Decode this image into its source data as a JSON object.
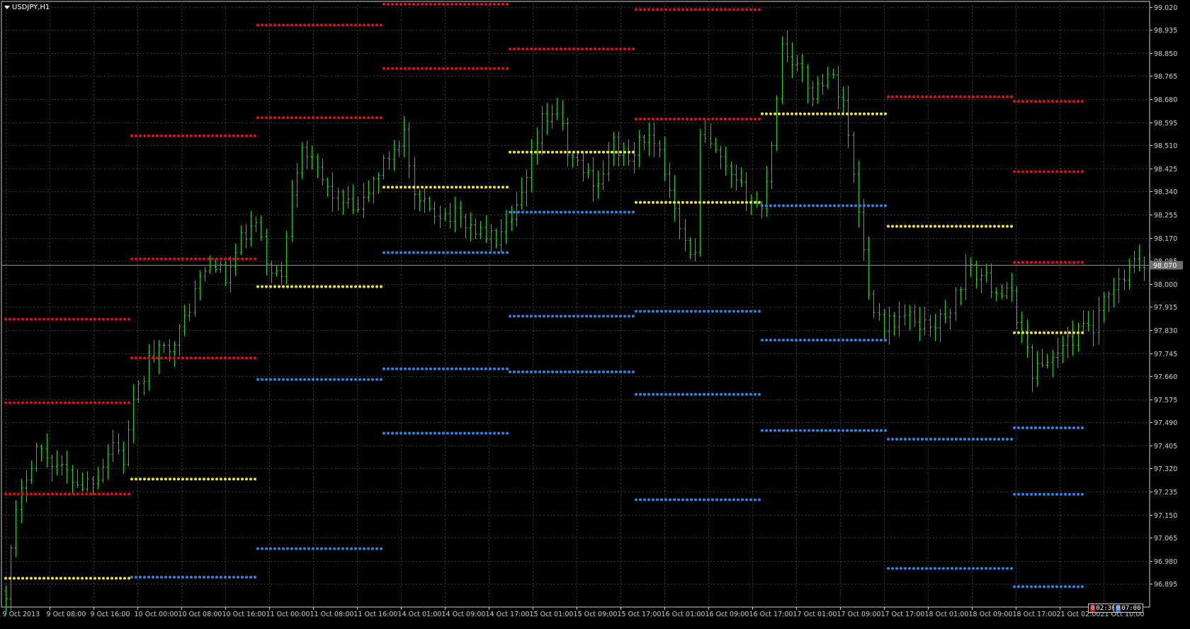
{
  "window": {
    "symbol_label": "USDJPY,H1"
  },
  "current_price": "98.070",
  "timers": [
    {
      "mark": "0",
      "text": "02:30"
    },
    {
      "mark": "0",
      "text": "07:00"
    }
  ],
  "colors": {
    "background": "#000000",
    "grid": "#3a3a3a",
    "axis": "#cfcfcf",
    "candle": "#1fd11f",
    "resistance": "#e01010",
    "pivot": "#f2e61c",
    "support": "#2a86e6",
    "price_line": "#8a8a8a"
  },
  "chart_data": {
    "type": "line",
    "symbol": "USDJPY",
    "timeframe": "H1",
    "y_ticks": [
      "99.020",
      "98.935",
      "98.850",
      "98.765",
      "98.680",
      "98.595",
      "98.510",
      "98.425",
      "98.340",
      "98.255",
      "98.170",
      "98.085",
      "98.000",
      "97.915",
      "97.830",
      "97.745",
      "97.660",
      "97.575",
      "97.490",
      "97.405",
      "97.320",
      "97.235",
      "97.150",
      "97.065",
      "96.980",
      "96.895"
    ],
    "ylim": [
      96.81,
      99.04
    ],
    "x_ticks": [
      "9 Oct 2013",
      "9 Oct 08:00",
      "9 Oct 16:00",
      "10 Oct 00:00",
      "10 Oct 08:00",
      "10 Oct 16:00",
      "11 Oct 00:00",
      "11 Oct 08:00",
      "11 Oct 16:00",
      "14 Oct 01:00",
      "14 Oct 09:00",
      "14 Oct 17:00",
      "15 Oct 01:00",
      "15 Oct 09:00",
      "15 Oct 17:00",
      "16 Oct 01:00",
      "16 Oct 09:00",
      "16 Oct 17:00",
      "17 Oct 01:00",
      "17 Oct 09:00",
      "17 Oct 17:00",
      "18 Oct 01:00",
      "18 Oct 09:00",
      "18 Oct 17:00",
      "21 Oct 02:00",
      "21 Oct 10:00"
    ],
    "grid": true,
    "price_path": [
      [
        0,
        96.87
      ],
      [
        2,
        97.15
      ],
      [
        4,
        97.3
      ],
      [
        6,
        97.4
      ],
      [
        9,
        97.35
      ],
      [
        12,
        97.3
      ],
      [
        15,
        97.26
      ],
      [
        18,
        97.3
      ],
      [
        21,
        97.42
      ],
      [
        23,
        97.35
      ],
      [
        25,
        97.55
      ],
      [
        28,
        97.72
      ],
      [
        31,
        97.76
      ],
      [
        34,
        97.82
      ],
      [
        38,
        98.02
      ],
      [
        41,
        98.08
      ],
      [
        43,
        98.01
      ],
      [
        46,
        98.16
      ],
      [
        49,
        98.22
      ],
      [
        51,
        98.08
      ],
      [
        54,
        98.02
      ],
      [
        56,
        98.35
      ],
      [
        58,
        98.52
      ],
      [
        60,
        98.44
      ],
      [
        63,
        98.35
      ],
      [
        66,
        98.3
      ],
      [
        69,
        98.26
      ],
      [
        72,
        98.38
      ],
      [
        75,
        98.47
      ],
      [
        78,
        98.56
      ],
      [
        80,
        98.3
      ],
      [
        84,
        98.27
      ],
      [
        88,
        98.25
      ],
      [
        92,
        98.2
      ],
      [
        96,
        98.16
      ],
      [
        99,
        98.22
      ],
      [
        102,
        98.37
      ],
      [
        105,
        98.6
      ],
      [
        108,
        98.64
      ],
      [
        110,
        98.48
      ],
      [
        113,
        98.42
      ],
      [
        116,
        98.37
      ],
      [
        119,
        98.52
      ],
      [
        122,
        98.45
      ],
      [
        125,
        98.55
      ],
      [
        128,
        98.47
      ],
      [
        131,
        98.3
      ],
      [
        133,
        98.15
      ],
      [
        135,
        98.1
      ],
      [
        136,
        98.54
      ],
      [
        139,
        98.48
      ],
      [
        142,
        98.38
      ],
      [
        145,
        98.33
      ],
      [
        148,
        98.27
      ],
      [
        150,
        98.52
      ],
      [
        152,
        98.88
      ],
      [
        155,
        98.8
      ],
      [
        158,
        98.7
      ],
      [
        161,
        98.78
      ],
      [
        164,
        98.68
      ],
      [
        166,
        98.4
      ],
      [
        168,
        98.15
      ],
      [
        169,
        97.95
      ],
      [
        172,
        97.85
      ],
      [
        176,
        97.88
      ],
      [
        180,
        97.85
      ],
      [
        184,
        97.87
      ],
      [
        187,
        98.0
      ],
      [
        188,
        98.05
      ],
      [
        191,
        98.03
      ],
      [
        194,
        97.98
      ],
      [
        197,
        97.95
      ],
      [
        199,
        97.82
      ],
      [
        201,
        97.68
      ],
      [
        203,
        97.7
      ],
      [
        206,
        97.75
      ],
      [
        209,
        97.8
      ],
      [
        212,
        97.85
      ],
      [
        213,
        97.82
      ],
      [
        215,
        97.93
      ],
      [
        217,
        97.97
      ],
      [
        219,
        98.02
      ],
      [
        221,
        98.07
      ],
      [
        224,
        98.06
      ]
    ],
    "pivot_days": [
      {
        "label": "9 Oct",
        "pivot": 96.916,
        "resistance": [
          97.226,
          97.562,
          97.87
        ],
        "support": []
      },
      {
        "label": "10 Oct",
        "pivot": 97.281,
        "resistance": [
          97.727,
          98.092,
          98.545
        ],
        "support": [
          96.92
        ]
      },
      {
        "label": "11 Oct",
        "pivot": 97.99,
        "resistance": [
          98.612,
          98.953
        ],
        "support": [
          97.648,
          97.025
        ]
      },
      {
        "label": "14 Oct",
        "pivot": 98.356,
        "resistance": [
          98.793,
          99.03
        ],
        "support": [
          98.115,
          97.687,
          97.45
        ]
      },
      {
        "label": "15 Oct",
        "pivot": 98.485,
        "resistance": [
          98.865
        ],
        "support": [
          98.264,
          97.881,
          97.676
        ]
      },
      {
        "label": "16 Oct",
        "pivot": 98.3,
        "resistance": [
          98.607,
          99.01
        ],
        "support": [
          97.899,
          97.593,
          97.205
        ]
      },
      {
        "label": "17 Oct",
        "pivot": 98.626,
        "resistance": [],
        "support": [
          98.288,
          97.793,
          97.46
        ]
      },
      {
        "label": "18 Oct",
        "pivot": 98.212,
        "resistance": [
          98.689
        ],
        "support": [
          97.428,
          96.952
        ]
      },
      {
        "label": "21 Oct",
        "pivot": 97.82,
        "resistance": [
          98.079,
          98.413,
          98.672
        ],
        "support": [
          97.47,
          97.225,
          96.885
        ]
      }
    ]
  }
}
